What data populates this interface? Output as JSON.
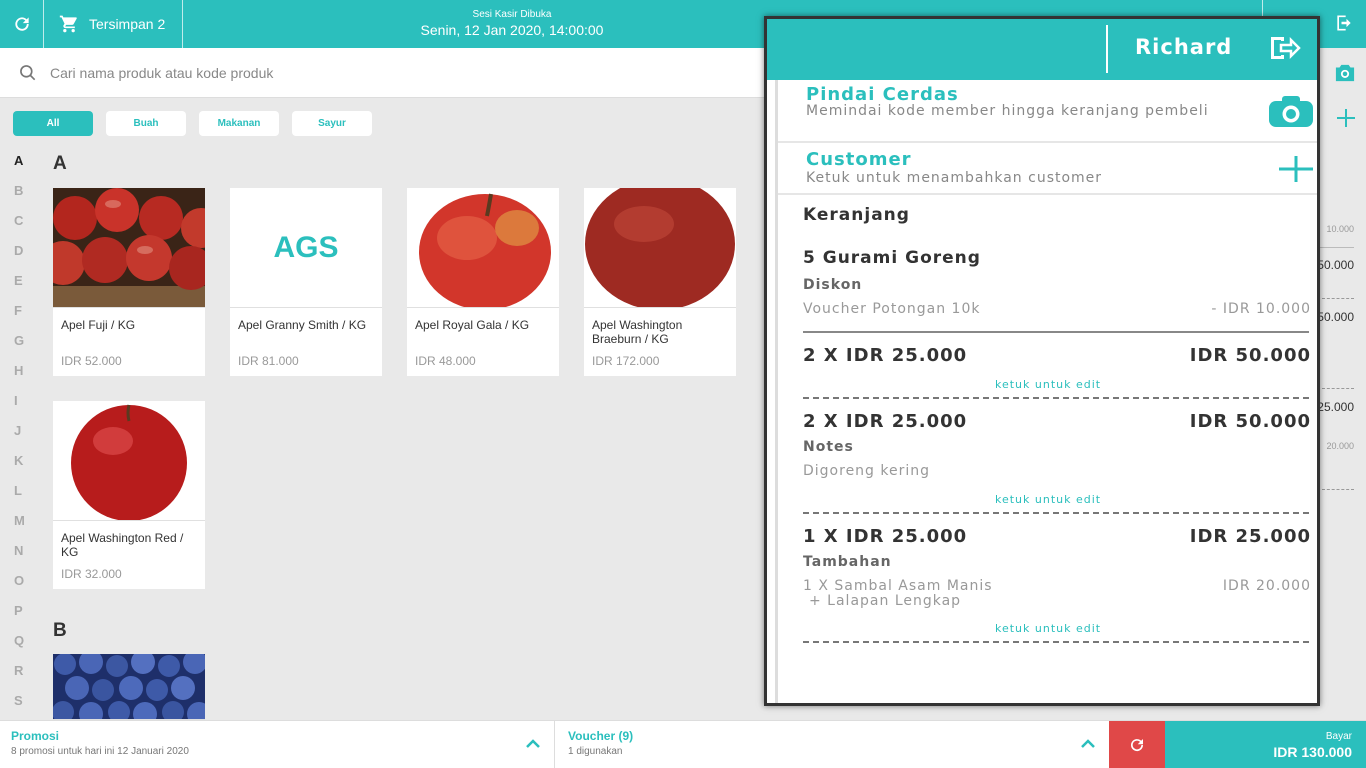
{
  "topbar": {
    "saved_label": "Tersimpan 2",
    "session_label": "Sesi Kasir Dibuka",
    "session_datetime": "Senin, 12 Jan 2020, 14:00:00"
  },
  "search": {
    "placeholder": "Cari nama produk atau kode produk"
  },
  "categories": [
    "All",
    "Buah",
    "Makanan",
    "Sayur"
  ],
  "alphabet": [
    "A",
    "B",
    "C",
    "D",
    "E",
    "F",
    "G",
    "H",
    "I",
    "J",
    "K",
    "L",
    "M",
    "N",
    "O",
    "P",
    "Q",
    "R",
    "S"
  ],
  "sections": [
    "A",
    "B"
  ],
  "products": [
    {
      "name": "Apel Fuji / KG",
      "price": "IDR 52.000"
    },
    {
      "name": "Apel Granny Smith / KG",
      "price": "IDR 81.000",
      "placeholder": "AGS"
    },
    {
      "name": "Apel Royal Gala / KG",
      "price": "IDR 48.000"
    },
    {
      "name": "Apel Washington Braeburn / KG",
      "price": "IDR 172.000"
    },
    {
      "name": "Apel Washington Red / KG",
      "price": "IDR 32.000"
    }
  ],
  "bottombar": {
    "promo_title": "Promosi",
    "promo_sub": "8 promosi untuk hari ini 12 Januari 2020",
    "voucher_title": "Voucher (9)",
    "voucher_sub": "1 digunakan",
    "pay_label": "Bayar",
    "pay_amount": "IDR 130.000"
  },
  "right_column": {
    "values": [
      "10.000",
      "50.000",
      "50.000",
      "25.000",
      "20.000"
    ]
  },
  "panel": {
    "user": "Richard",
    "smart_scan_title": "Pindai Cerdas",
    "smart_scan_desc": "Memindai kode member hingga keranjang pembeli",
    "customer_title": "Customer",
    "customer_desc": "Ketuk untuk menambahkan customer",
    "cart_title": "Keranjang",
    "item_name": "5 Gurami Goreng",
    "discount_label": "Diskon",
    "voucher_name": "Voucher Potongan 10k",
    "voucher_amount": "- IDR 10.000",
    "line1_qty": "2 X IDR 25.000",
    "line1_total": "IDR 50.000",
    "edit_label": "ketuk untuk edit",
    "line2_qty": "2 X IDR 25.000",
    "line2_total": "IDR 50.000",
    "notes_label": "Notes",
    "notes_text": "Digoreng kering",
    "line3_qty": "1 X IDR 25.000",
    "line3_total": "IDR 25.000",
    "addon_label": "Tambahan",
    "addon_text_1": "1 X Sambal Asam Manis",
    "addon_text_2": "+ Lalapan Lengkap",
    "addon_amount": "IDR 20.000"
  },
  "colors": {
    "accent": "#2bbfbd",
    "danger": "#e04848"
  }
}
